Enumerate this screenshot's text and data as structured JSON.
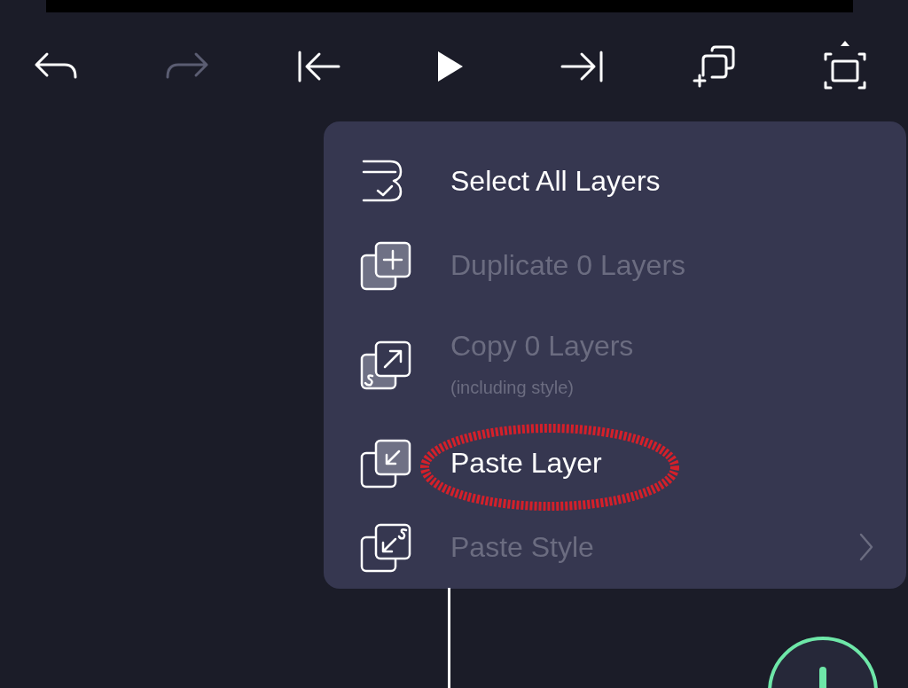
{
  "toolbar": [
    {
      "kind": "undo",
      "disabled": false
    },
    {
      "kind": "redo",
      "disabled": true
    },
    {
      "kind": "skip-start",
      "disabled": false
    },
    {
      "kind": "play",
      "disabled": false
    },
    {
      "kind": "skip-end",
      "disabled": false
    },
    {
      "kind": "duplicate",
      "disabled": false
    },
    {
      "kind": "fullscreen",
      "disabled": false
    }
  ],
  "menu": [
    {
      "kind": "select-all",
      "label": "Select All Layers",
      "disabled": false,
      "circled": false
    },
    {
      "kind": "duplicate",
      "label": "Duplicate 0 Layers",
      "disabled": true,
      "circled": false
    },
    {
      "kind": "copy",
      "label": "Copy 0 Layers",
      "subtitle": "(including style)",
      "disabled": true,
      "circled": false
    },
    {
      "kind": "paste",
      "label": "Paste Layer",
      "disabled": false,
      "circled": true
    },
    {
      "kind": "paste-style",
      "label": "Paste Style",
      "disabled": true,
      "circled": false,
      "submenu": true
    }
  ]
}
